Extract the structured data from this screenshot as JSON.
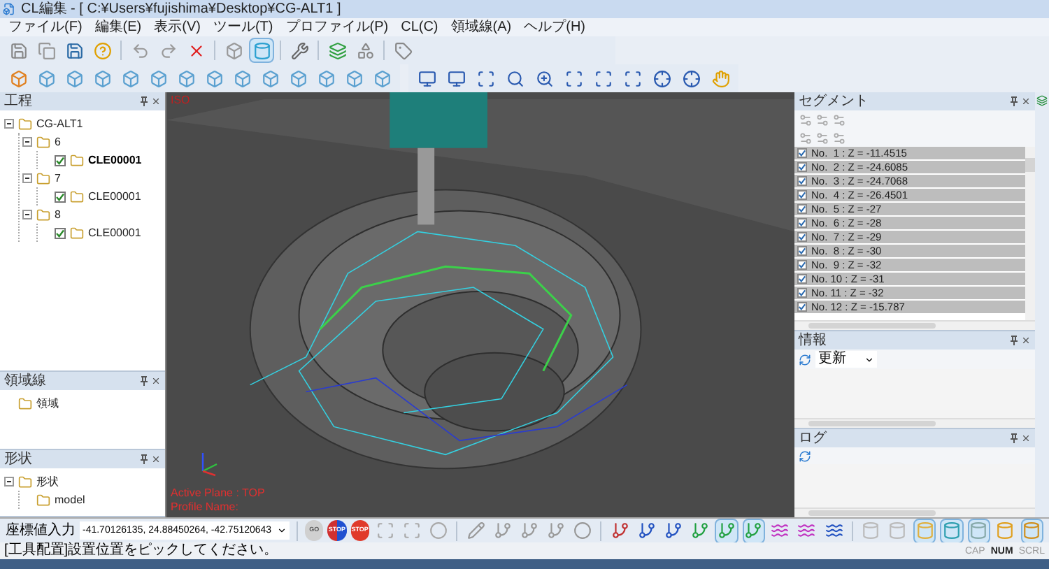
{
  "window": {
    "title": "CL編集 - [ C:¥Users¥fujishima¥Desktop¥CG-ALT1 ]"
  },
  "menu": [
    "ファイル(F)",
    "編集(E)",
    "表示(V)",
    "ツール(T)",
    "プロファイル(P)",
    "CL(C)",
    "領域線(A)",
    "ヘルプ(H)"
  ],
  "process_panel": {
    "title": "工程",
    "tree": [
      {
        "label": "CG-ALT1",
        "expanded": true,
        "children": [
          {
            "label": "6",
            "expanded": true,
            "children": [
              {
                "label": "CLE00001",
                "checked": true,
                "selected": true
              }
            ]
          },
          {
            "label": "7",
            "expanded": true,
            "children": [
              {
                "label": "CLE00001",
                "checked": true,
                "selected": false
              }
            ]
          },
          {
            "label": "8",
            "expanded": true,
            "children": [
              {
                "label": "CLE00001",
                "checked": true,
                "selected": false
              }
            ]
          }
        ]
      }
    ]
  },
  "region_panel": {
    "title": "領域線",
    "tree": [
      {
        "label": "領域"
      }
    ]
  },
  "shape_panel": {
    "title": "形状",
    "tree": [
      {
        "label": "形状",
        "expanded": true,
        "children": [
          {
            "label": "model"
          }
        ]
      }
    ]
  },
  "viewport": {
    "view_label": "ISO",
    "active_plane": "Active Plane : TOP",
    "profile_name": "Profile Name:"
  },
  "segment_panel": {
    "title": "セグメント",
    "rows": [
      {
        "label": "No.  1 : Z = -11.4515",
        "checked": true
      },
      {
        "label": "No.  2 : Z = -24.6085",
        "checked": true
      },
      {
        "label": "No.  3 : Z = -24.7068",
        "checked": true
      },
      {
        "label": "No.  4 : Z = -26.4501",
        "checked": true
      },
      {
        "label": "No.  5 : Z = -27",
        "checked": true
      },
      {
        "label": "No.  6 : Z = -28",
        "checked": true
      },
      {
        "label": "No.  7 : Z = -29",
        "checked": true
      },
      {
        "label": "No.  8 : Z = -30",
        "checked": true
      },
      {
        "label": "No.  9 : Z = -32",
        "checked": true
      },
      {
        "label": "No. 10 : Z = -31",
        "checked": true
      },
      {
        "label": "No. 11 : Z = -32",
        "checked": true
      },
      {
        "label": "No. 12 : Z = -15.787",
        "checked": true
      }
    ]
  },
  "info_panel": {
    "title": "情報",
    "dropdown": "更新"
  },
  "log_panel": {
    "title": "ログ"
  },
  "coord_input": {
    "label": "座標値入力",
    "value": "-41.70126135, 24.88450264, -42.75120643"
  },
  "run_buttons": [
    {
      "label": "GO",
      "kind": "go",
      "disabled": true
    },
    {
      "label": "STOP",
      "kind": "dual",
      "disabled": false
    },
    {
      "label": "STOP",
      "kind": "single",
      "disabled": false
    }
  ],
  "status_bar": {
    "message": "[工具配置]設置位置をピックしてください。",
    "indicators": [
      {
        "label": "CAP",
        "on": false
      },
      {
        "label": "NUM",
        "on": true
      },
      {
        "label": "SCRL",
        "on": false
      }
    ]
  }
}
